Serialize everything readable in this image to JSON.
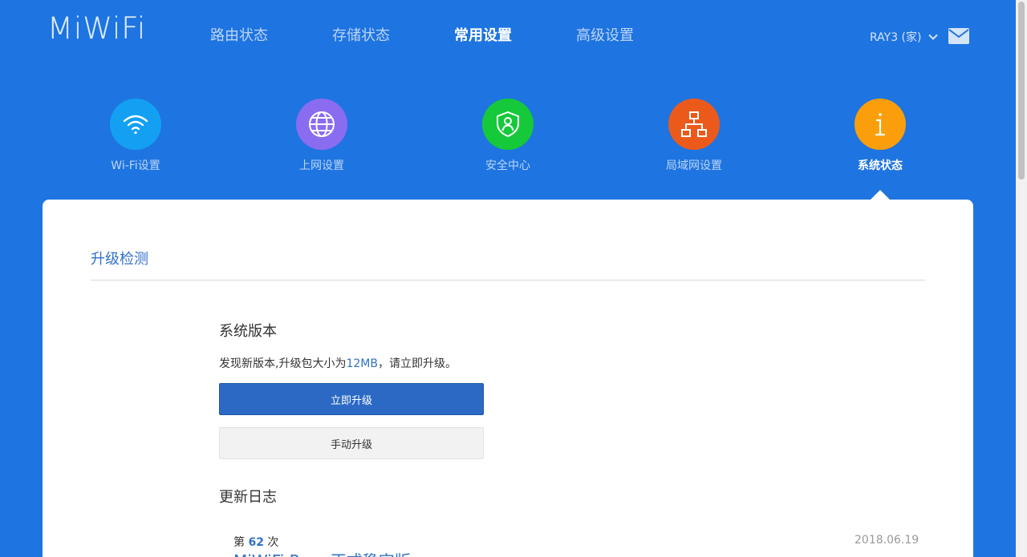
{
  "brand": {
    "logo_text": "MiWiFi"
  },
  "nav": {
    "items": [
      {
        "label": "路由状态"
      },
      {
        "label": "存储状态"
      },
      {
        "label": "常用设置"
      },
      {
        "label": "高级设置"
      }
    ],
    "active_index": 2
  },
  "user": {
    "label": "RAY3 (家)"
  },
  "categories": [
    {
      "label": "Wi-Fi设置",
      "icon": "wifi-icon",
      "color": "#13a0f3"
    },
    {
      "label": "上网设置",
      "icon": "globe-icon",
      "color": "#8a6cf0"
    },
    {
      "label": "安全中心",
      "icon": "shield-icon",
      "color": "#15c93a"
    },
    {
      "label": "局域网设置",
      "icon": "network-icon",
      "color": "#ec5a1b"
    },
    {
      "label": "系统状态",
      "icon": "info-icon",
      "color": "#fa9e0c"
    }
  ],
  "active_category_index": 4,
  "main": {
    "section_title": "升级检测",
    "version_heading": "系统版本",
    "update_text_before": "发现新版本,升级包大小为",
    "update_size": "12MB",
    "update_text_after": "，请立即升级。",
    "upgrade_now_label": "立即升级",
    "manual_upgrade_label": "手动升级",
    "changelog_heading": "更新日志",
    "changelog": {
      "prefix": "第",
      "number": "62",
      "suffix": "次",
      "date": "2018.06.19",
      "title": "MiWiFi Rom 正式稳定版"
    }
  },
  "colors": {
    "background": "#1e74e0",
    "accent": "#3271c7",
    "primary_button": "#2b69c4"
  }
}
